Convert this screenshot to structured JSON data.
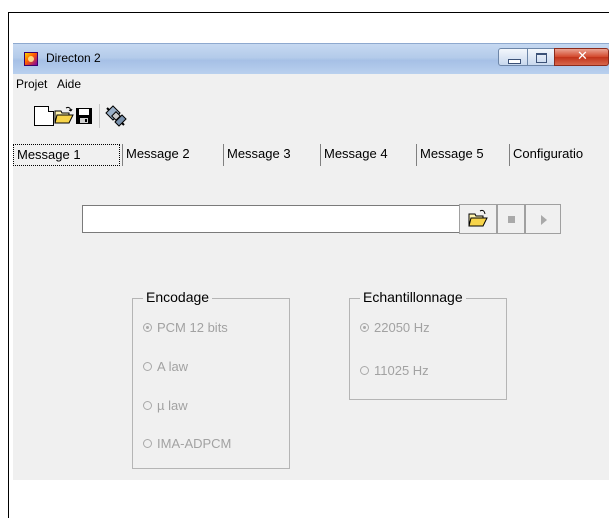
{
  "window": {
    "title": "Directon 2",
    "icon": "app-icon",
    "controls": [
      "minimize-icon",
      "maximize-icon",
      "close-icon"
    ]
  },
  "menu": {
    "items": [
      "Projet",
      "Aide"
    ]
  },
  "toolbar": {
    "buttons": [
      "new-file-icon",
      "open-folder-icon",
      "save-disk-icon",
      "satellite-icon"
    ]
  },
  "tabs": {
    "items": [
      "Message 1",
      "Message 2",
      "Message 3",
      "Message 4",
      "Message 5",
      "Configuratio"
    ],
    "active": "Message 1"
  },
  "file": {
    "path_value": "",
    "buttons": [
      "open-folder-icon",
      "stop-icon",
      "play-icon"
    ]
  },
  "encodage": {
    "title": "Encodage",
    "options": [
      "PCM 12 bits",
      "A law",
      "µ law",
      "IMA-ADPCM"
    ],
    "selected": "PCM 12 bits"
  },
  "echantillonnage": {
    "title": "Echantillonnage",
    "options": [
      "22050 Hz",
      "11025 Hz"
    ],
    "selected": "22050 Hz"
  },
  "colors": {
    "client_bg": "#f0f0f0",
    "disabled_text": "#a2a2a2",
    "close_red": "#c1331a"
  }
}
